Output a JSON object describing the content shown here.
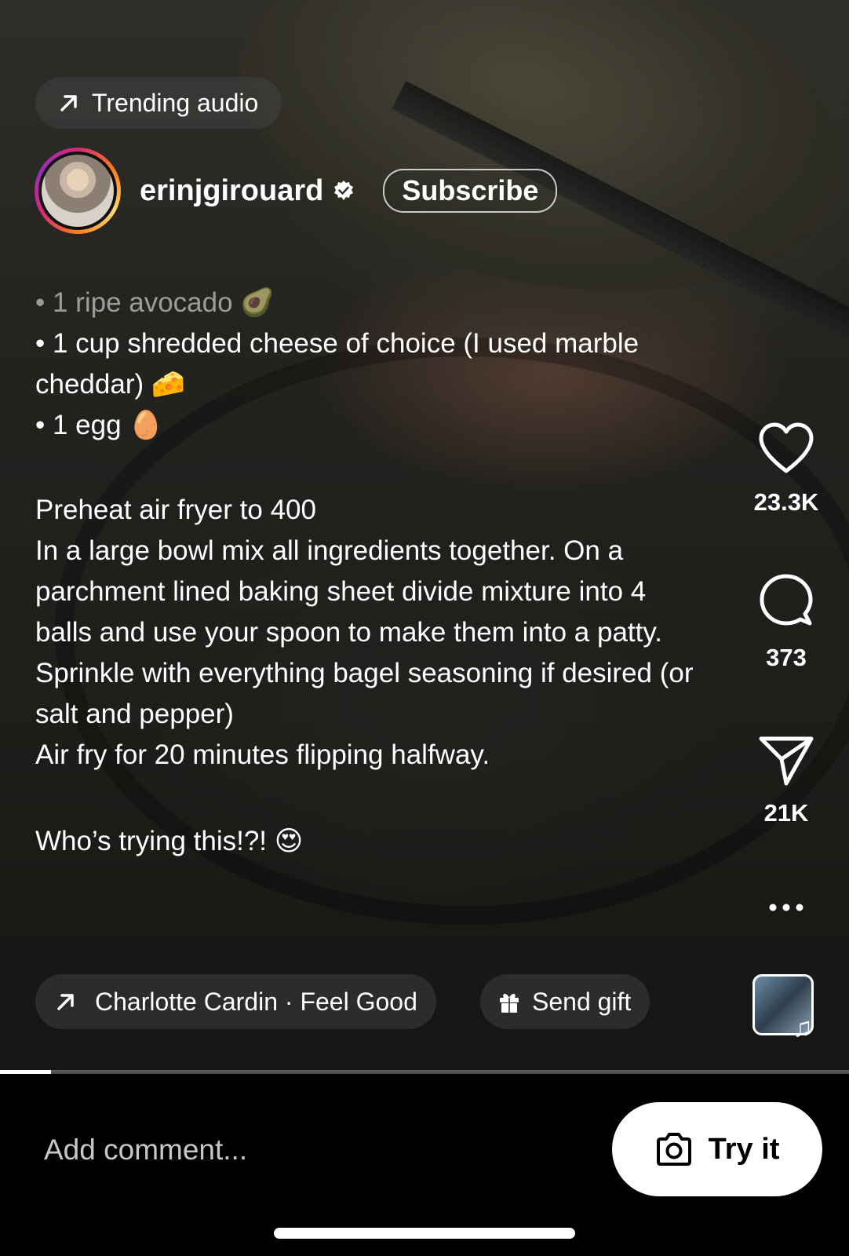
{
  "video": {
    "progress": 0.06
  },
  "trending": {
    "label": "Trending audio"
  },
  "profile": {
    "username": "erinjgirouard",
    "subscribe_label": "Subscribe"
  },
  "caption": {
    "line1": "• 1 ripe avocado 🥑",
    "line2": "• 1 cup shredded cheese of choice (I used marble cheddar) 🧀",
    "line3": "• 1 egg 🥚",
    "line4": "Preheat air fryer to 400",
    "line5": "In a large bowl mix all ingredients together. On a parchment lined baking sheet divide mixture into 4 balls and use your spoon to make them into a patty.",
    "line6": "Sprinkle with everything bagel seasoning if desired (or salt and pepper)",
    "line7": "Air fry for 20 minutes flipping halfway.",
    "line8": "Who’s trying this!?! 😍"
  },
  "actions": {
    "likes": "23.3K",
    "comments": "373",
    "shares": "21K"
  },
  "audio": {
    "label": "Charlotte Cardin · Feel Good"
  },
  "gift": {
    "label": "Send gift"
  },
  "bottom": {
    "comment_placeholder": "Add comment...",
    "try_label": "Try it"
  },
  "icons": {
    "heart": "heart-icon",
    "comment": "comment-icon",
    "share": "send-icon",
    "more": "more-icon",
    "gift": "gift-icon",
    "camera": "camera-icon",
    "music": "music-note-icon"
  }
}
